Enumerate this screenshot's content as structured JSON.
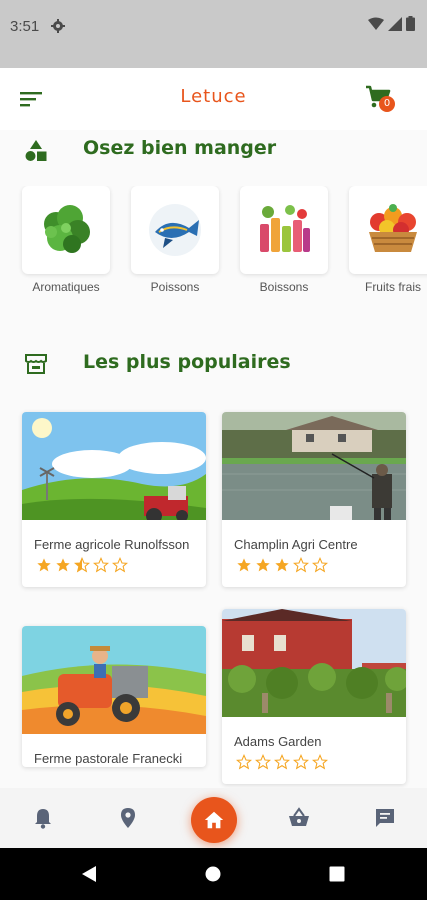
{
  "status_bar": {
    "time": "3:51"
  },
  "app_bar": {
    "title": "Letuce",
    "cart_count": "0"
  },
  "sections": {
    "categories_title": "Osez bien manger",
    "popular_title": "Les plus populaires"
  },
  "categories": [
    {
      "label": "Aromatiques",
      "icon": "herbs-image"
    },
    {
      "label": "Poissons",
      "icon": "fish-image"
    },
    {
      "label": "Boissons",
      "icon": "drinks-image"
    },
    {
      "label": "Fruits frais",
      "icon": "fruit-basket-image"
    }
  ],
  "popular": [
    {
      "name": "Ferme agricole Runolfsson",
      "rating": 2.5
    },
    {
      "name": "Champlin Agri Centre",
      "rating": 3
    },
    {
      "name": "Ferme pastorale Franecki",
      "rating": null
    },
    {
      "name": "Adams Garden",
      "rating": 0
    }
  ],
  "colors": {
    "accent": "#e8551c",
    "brand_green": "#2e6b1f",
    "star": "#f5a623"
  }
}
